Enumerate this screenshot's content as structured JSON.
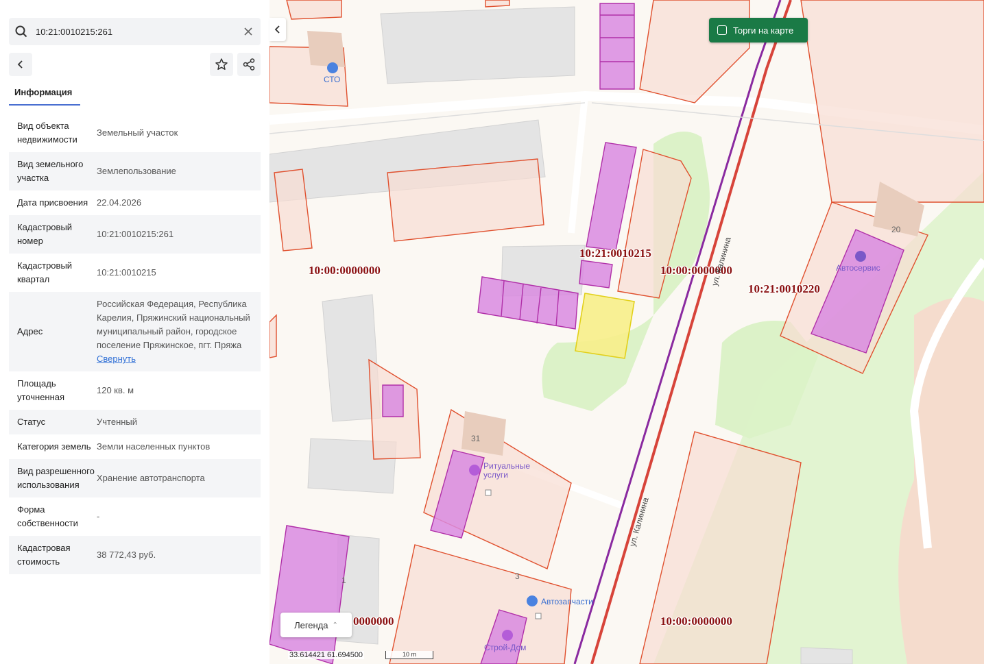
{
  "search": {
    "value": "10:21:0010215:261"
  },
  "tabs": {
    "info_label": "Информация"
  },
  "info_rows": [
    {
      "label": "Вид объекта недвижимости",
      "value": "Земельный участок"
    },
    {
      "label": "Вид земельного участка",
      "value": "Землепользование"
    },
    {
      "label": "Дата присвоения",
      "value": "22.04.2026"
    },
    {
      "label": "Кадастровый номер",
      "value": "10:21:0010215:261"
    },
    {
      "label": "Кадастровый квартал",
      "value": "10:21:0010215"
    },
    {
      "label": "Адрес",
      "value": "Российская Федерация, Республика Карелия, Пряжинский национальный муниципальный район, городское поселение Пряжинское, пгт. Пряжа",
      "link": "Свернуть"
    },
    {
      "label": "Площадь уточненная",
      "value": "120 кв. м"
    },
    {
      "label": "Статус",
      "value": "Учтенный"
    },
    {
      "label": "Категория земель",
      "value": "Земли населенных пунктов"
    },
    {
      "label": "Вид разрешенного использования",
      "value": "Хранение автотранспорта"
    },
    {
      "label": "Форма собственности",
      "value": "-"
    },
    {
      "label": "Кадастровая стоимость",
      "value": "38 772,43 руб."
    }
  ],
  "map": {
    "torgi_label": "Торги на карте",
    "legend_label": "Легенда",
    "coords": "33.614421  61.694500",
    "scale_label": "10 m",
    "cadastral_labels": {
      "q1": "10:00:0000000",
      "q2": "10:21:0010215",
      "q3": "10:00:0000000",
      "q4": "10:21:0010220",
      "q5": "0000000",
      "q6": "10:00:0000000"
    },
    "poi": {
      "sto": "СТО",
      "avtoservis": "Автосервис",
      "ritual_1": "Ритуальные",
      "ritual_2": "услуги",
      "avtozapchasti": "Автозапчасти",
      "stroidom": "Строй-Дом"
    },
    "building_numbers": {
      "b20": "20",
      "b31": "31",
      "b3": "3",
      "b1": "1"
    },
    "streets": {
      "kalinina_1": "ул. Калинина",
      "kalinina_2": "ул. Калинина"
    },
    "colors": {
      "parcel_stroke": "#e0502e",
      "parcel_fill": "#f8ddd3",
      "building_fill": "#d98be0",
      "building_stroke": "#b02fa8",
      "selected_fill": "#f7ee8a",
      "selected_stroke": "#e2d01a",
      "green": "#dcf2c8",
      "road_red": "#d7443a",
      "road_purple": "#8a2aa0",
      "torgi_bg": "#1a7a46"
    }
  }
}
